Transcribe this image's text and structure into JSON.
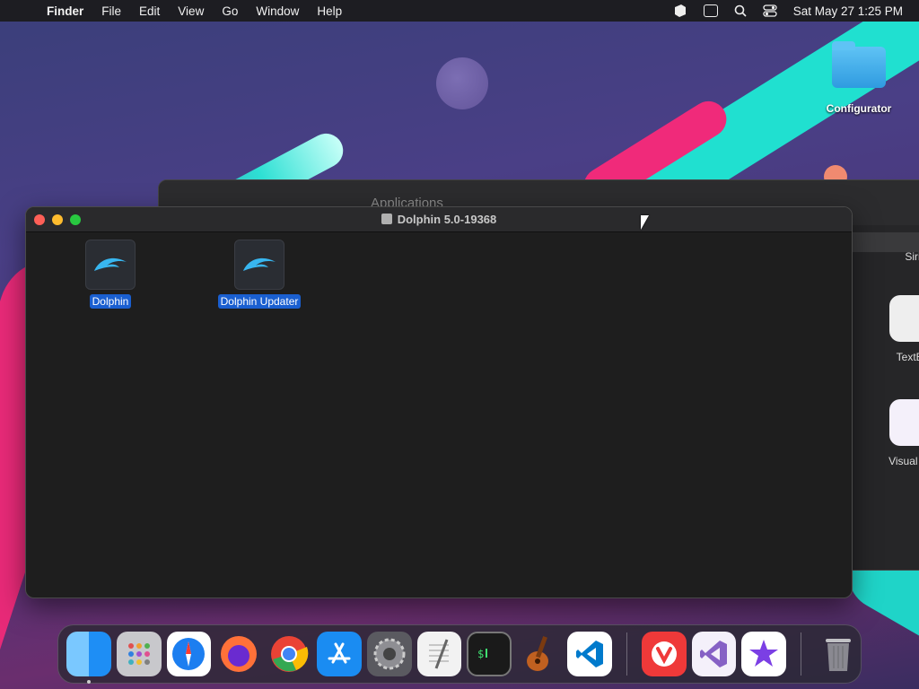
{
  "menubar": {
    "app_name": "Finder",
    "items": [
      "File",
      "Edit",
      "View",
      "Go",
      "Window",
      "Help"
    ],
    "clock": "Sat May 27  1:25 PM"
  },
  "desktop": {
    "folder_label": "Configurator"
  },
  "background_window": {
    "title": "Applications",
    "apps": [
      "Siri",
      "TextEd",
      "Visual Stu"
    ]
  },
  "finder_window": {
    "title": "Dolphin 5.0-19368",
    "files": [
      {
        "label": "Dolphin"
      },
      {
        "label": "Dolphin Updater"
      }
    ]
  },
  "dock": {
    "apps": [
      {
        "name": "finder-icon",
        "color": "#1e8ef5"
      },
      {
        "name": "launchpad-icon",
        "color": "#c8c8cc"
      },
      {
        "name": "safari-icon",
        "color": "#1c7ef0"
      },
      {
        "name": "firefox-icon",
        "color": "#ff7139"
      },
      {
        "name": "chrome-icon",
        "color": "#fbbc05"
      },
      {
        "name": "app-store-icon",
        "color": "#1a8cf2"
      },
      {
        "name": "system-preferences-icon",
        "color": "#8e8e93"
      },
      {
        "name": "textedit-icon",
        "color": "#f2f2f2"
      },
      {
        "name": "terminal-icon",
        "color": "#1a1a1a"
      },
      {
        "name": "garageband-icon",
        "color": "#f08a20"
      },
      {
        "name": "vscode-icon",
        "color": "#007acc"
      }
    ],
    "recent_apps": [
      {
        "name": "vivaldi-icon",
        "color": "#ef3939"
      },
      {
        "name": "visual-studio-icon",
        "color": "#8661c5"
      },
      {
        "name": "imovie-icon",
        "color": "#7b3fe4"
      }
    ],
    "trash": {
      "name": "trash-icon",
      "color": "#9a9aa0"
    }
  }
}
